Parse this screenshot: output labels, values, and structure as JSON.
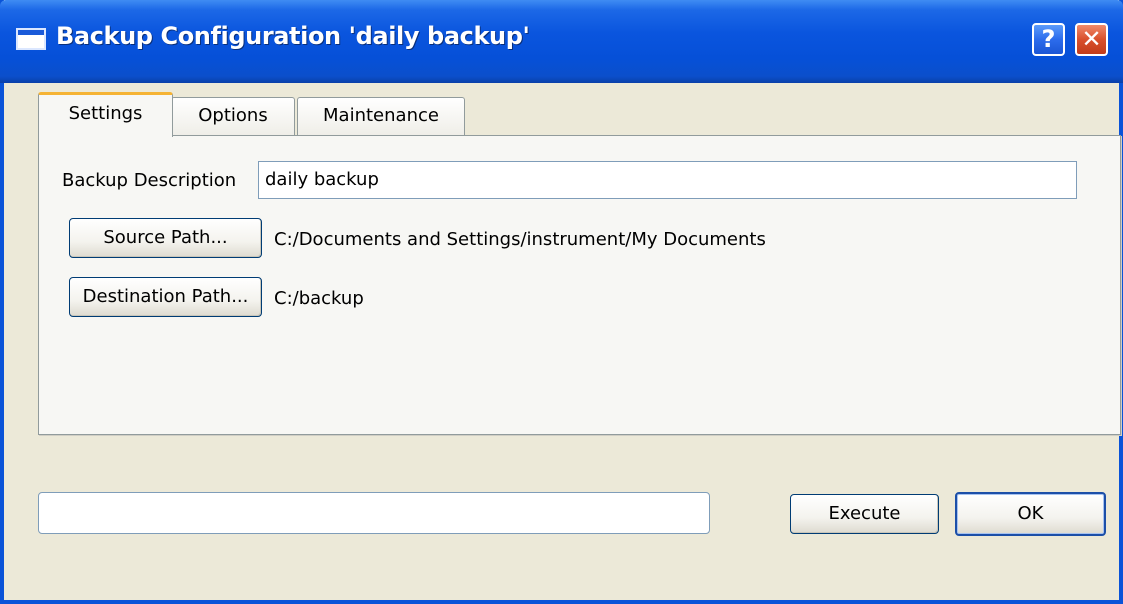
{
  "window": {
    "title": "Backup Configuration 'daily backup'",
    "help_glyph": "?",
    "close_glyph": "✕",
    "icon": "window-icon"
  },
  "tabs": [
    {
      "label": "Settings",
      "selected": true
    },
    {
      "label": "Options",
      "selected": false
    },
    {
      "label": "Maintenance",
      "selected": false
    }
  ],
  "settings": {
    "description_label": "Backup Description",
    "description_value": "daily backup",
    "source_button": "Source Path...",
    "source_path": "C:/Documents and Settings/instrument/My Documents",
    "destination_button": "Destination Path...",
    "destination_path": "C:/backup"
  },
  "footer": {
    "status_value": "",
    "execute_label": "Execute",
    "ok_label": "OK"
  },
  "colors": {
    "titlebar": "#0a55de",
    "dialog_bg": "#ece9d8",
    "tab_pane_bg": "#f7f7f4",
    "selected_tab_accent": "#f5b334",
    "close_button": "#d9502c"
  }
}
